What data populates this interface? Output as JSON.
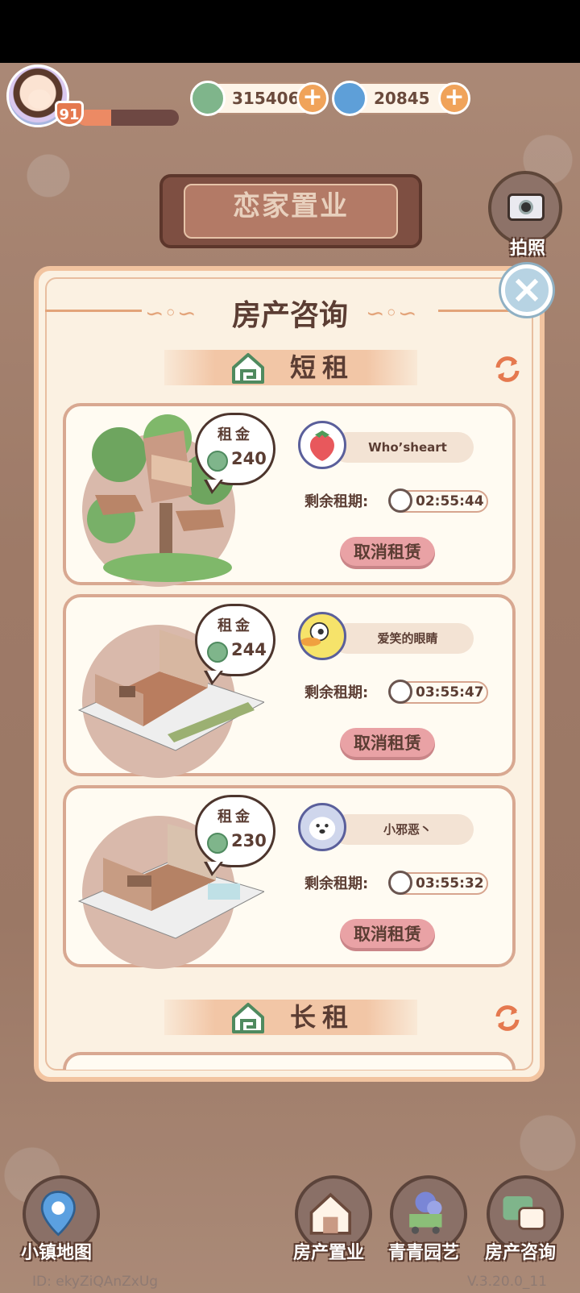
{
  "player": {
    "level": "91",
    "xp_fraction": 0.33
  },
  "currencies": [
    {
      "name": "clover-coin",
      "value": "315406",
      "color": "#7fb58b"
    },
    {
      "name": "blue-swirl-gem",
      "value": "20845",
      "color": "#5e9fd8"
    }
  ],
  "banner": {
    "title": "恋家置业"
  },
  "camera": {
    "label": "拍照"
  },
  "panel": {
    "title": "房产咨询"
  },
  "sections": {
    "short": {
      "label": "短租"
    },
    "long": {
      "label": "长租"
    }
  },
  "rent_label": "租金",
  "remaining_label": "剩余租期:",
  "cancel_label": "取消租赁",
  "rentals": [
    {
      "rent": "240",
      "tenant": "Who’sheart",
      "remaining": "02:55:44"
    },
    {
      "rent": "244",
      "tenant": "爱笑的眼睛",
      "remaining": "03:55:47"
    },
    {
      "rent": "230",
      "tenant": "小邪恶丶",
      "remaining": "03:55:32"
    }
  ],
  "nav": {
    "map": "小镇地图",
    "property": "房产置业",
    "garden": "青青园艺",
    "consult": "房产咨询"
  },
  "footer": {
    "id": "ID: ekyZiQAnZxUg",
    "version": "V.3.20.0_11"
  },
  "colors": {
    "accent": "#f2c4a0",
    "cancel": "#e9a2a5",
    "text": "#5b3d33"
  }
}
